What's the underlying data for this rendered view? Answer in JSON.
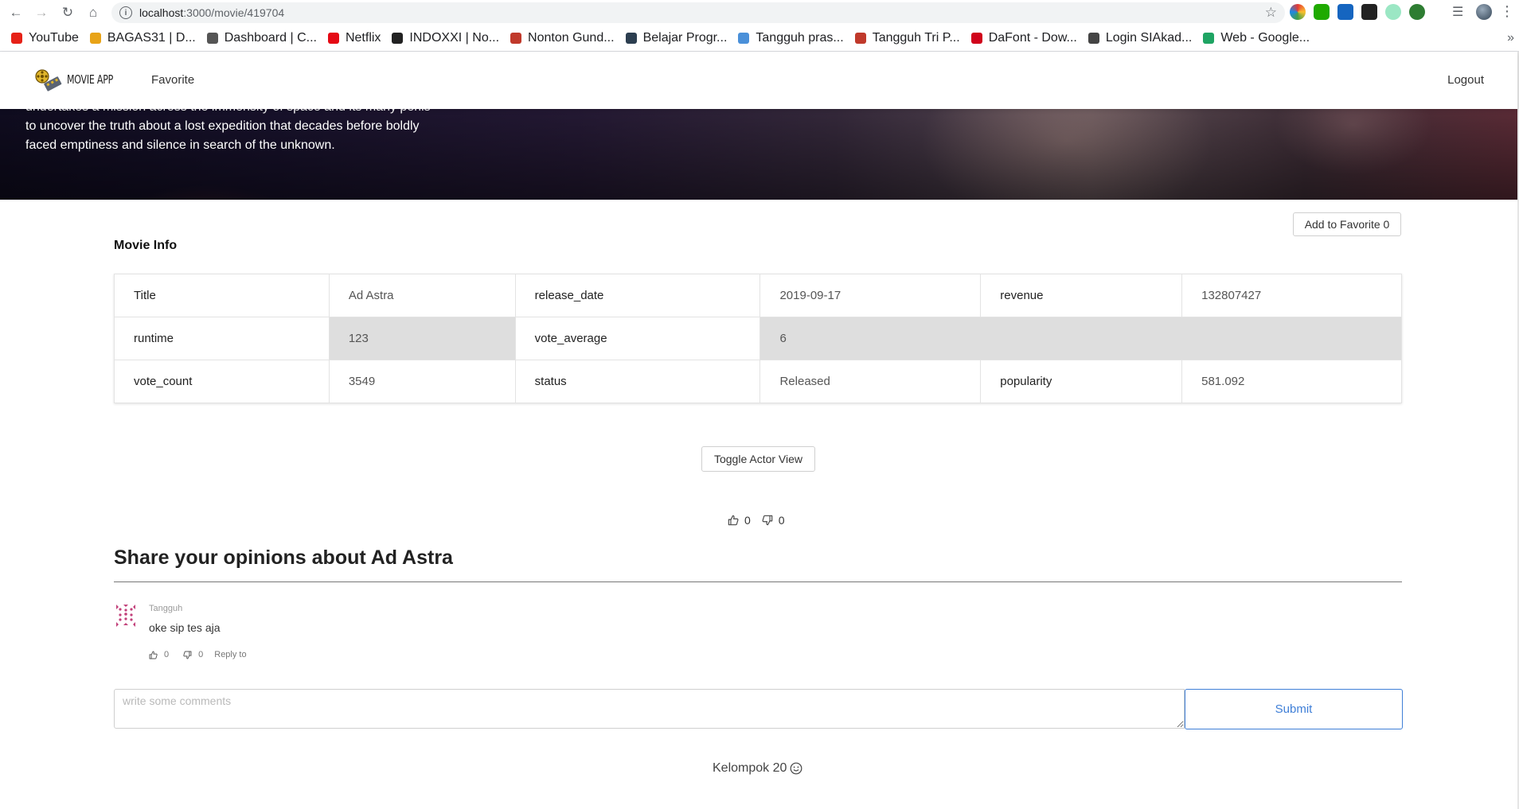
{
  "browser": {
    "url_host": "localhost",
    "url_path": ":3000/movie/419704",
    "bookmarks": [
      {
        "label": "YouTube",
        "color": "#e62117"
      },
      {
        "label": "BAGAS31 | D...",
        "color": "#e8a317"
      },
      {
        "label": "Dashboard | C...",
        "color": "#555555"
      },
      {
        "label": "Netflix",
        "color": "#e50914"
      },
      {
        "label": "INDOXXI | No...",
        "color": "#222222"
      },
      {
        "label": "Nonton Gund...",
        "color": "#c0392b"
      },
      {
        "label": "Belajar Progr...",
        "color": "#2c3e50"
      },
      {
        "label": "Tangguh pras...",
        "color": "#4a90d9"
      },
      {
        "label": "Tangguh Tri P...",
        "color": "#c0392b"
      },
      {
        "label": "DaFont - Dow...",
        "color": "#d0021b"
      },
      {
        "label": "Login SIAkad...",
        "color": "#444444"
      },
      {
        "label": "Web - Google...",
        "color": "#1fa463"
      }
    ],
    "bookmarks_more": "»"
  },
  "navbar": {
    "logo_text": "MOVIE APP",
    "favorite_link": "Favorite",
    "logout_link": "Logout"
  },
  "hero": {
    "overview": "undertakes a mission across the immensity of space and its many perils to uncover the truth about a lost expedition that decades before boldly faced emptiness and silence in search of the unknown."
  },
  "add_favorite_label": "Add to Favorite 0",
  "movie_info": {
    "title": "Movie Info",
    "rows": [
      [
        [
          "Title",
          "Ad Astra"
        ],
        [
          "release_date",
          "2019-09-17"
        ],
        [
          "revenue",
          "132807427"
        ]
      ],
      [
        [
          "runtime",
          "123"
        ],
        [
          "vote_average",
          "6"
        ]
      ],
      [
        [
          "vote_count",
          "3549"
        ],
        [
          "status",
          "Released"
        ],
        [
          "popularity",
          "581.092"
        ]
      ]
    ]
  },
  "toggle_actor_label": "Toggle Actor View",
  "movie_votes": {
    "likes": "0",
    "dislikes": "0"
  },
  "comments_section": {
    "heading": "Share your opinions about Ad Astra",
    "comments": [
      {
        "author": "Tangguh",
        "text": "oke sip tes aja",
        "likes": "0",
        "dislikes": "0",
        "reply_label": "Reply to"
      }
    ],
    "placeholder": "write some comments",
    "submit_label": "Submit"
  },
  "footer": {
    "text": "Kelompok 20"
  },
  "colors": {
    "accent": "#3f7fd7",
    "row_shade": "#dedede"
  }
}
